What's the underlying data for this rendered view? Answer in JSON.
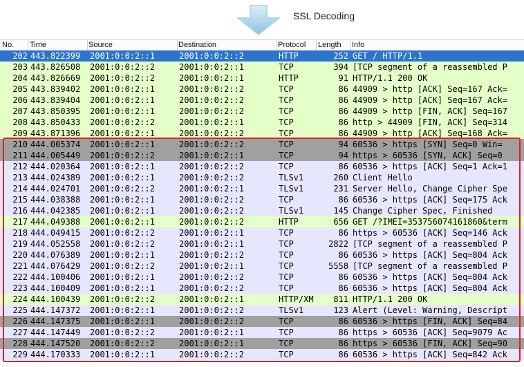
{
  "banner": {
    "title": "SSL Decoding",
    "icon": "down-arrow-icon"
  },
  "columns": [
    "No.",
    "Time",
    "Source",
    "Destination",
    "Protocol",
    "Length",
    "Info"
  ],
  "colors": {
    "http": "#e4ffc7",
    "tcp": "#e7e6ff",
    "gray": "#a0a0a0",
    "selected": "#2c74cc",
    "highlight_box": "#e02020"
  },
  "packets": [
    {
      "no": "202",
      "time": "443.822399",
      "src": "2001:0:0:2::1",
      "dst": "2001:0:0:2::2",
      "proto": "HTTP",
      "len": "252",
      "info": "GET / HTTP/1.1",
      "style": "sel"
    },
    {
      "no": "203",
      "time": "443.826508",
      "src": "2001:0:0:2::2",
      "dst": "2001:0:0:2::1",
      "proto": "TCP",
      "len": "394",
      "info": "[TCP segment of a reassembled P",
      "style": "http"
    },
    {
      "no": "204",
      "time": "443.826669",
      "src": "2001:0:0:2::2",
      "dst": "2001:0:0:2::1",
      "proto": "HTTP",
      "len": "91",
      "info": "HTTP/1.1 200 OK",
      "style": "http"
    },
    {
      "no": "205",
      "time": "443.839402",
      "src": "2001:0:0:2::1",
      "dst": "2001:0:0:2::2",
      "proto": "TCP",
      "len": "86",
      "info": "44909 > http [ACK] Seq=167 Ack=",
      "style": "http"
    },
    {
      "no": "206",
      "time": "443.839404",
      "src": "2001:0:0:2::1",
      "dst": "2001:0:0:2::2",
      "proto": "TCP",
      "len": "86",
      "info": "44909 > http [ACK] Seq=167 Ack=",
      "style": "http"
    },
    {
      "no": "207",
      "time": "443.850395",
      "src": "2001:0:0:2::1",
      "dst": "2001:0:0:2::2",
      "proto": "TCP",
      "len": "86",
      "info": "44909 > http [FIN, ACK] Seq=167",
      "style": "http"
    },
    {
      "no": "208",
      "time": "443.850433",
      "src": "2001:0:0:2::2",
      "dst": "2001:0:0:2::1",
      "proto": "TCP",
      "len": "86",
      "info": "http > 44909 [FIN, ACK] Seq=314",
      "style": "http"
    },
    {
      "no": "209",
      "time": "443.871396",
      "src": "2001:0:0:2::1",
      "dst": "2001:0:0:2::2",
      "proto": "TCP",
      "len": "86",
      "info": "44909 > http [ACK] Seq=168 Ack=",
      "style": "http"
    },
    {
      "no": "210",
      "time": "444.005374",
      "src": "2001:0:0:2::1",
      "dst": "2001:0:0:2::2",
      "proto": "TCP",
      "len": "94",
      "info": "60536 > https [SYN] Seq=0 Win=",
      "style": "gray"
    },
    {
      "no": "211",
      "time": "444.005449",
      "src": "2001:0:0:2::2",
      "dst": "2001:0:0:2::1",
      "proto": "TCP",
      "len": "94",
      "info": "https > 60536 [SYN, ACK] Seq=0",
      "style": "gray"
    },
    {
      "no": "212",
      "time": "444.020364",
      "src": "2001:0:0:2::1",
      "dst": "2001:0:0:2::2",
      "proto": "TCP",
      "len": "86",
      "info": "60536 > https [ACK] Seq=1 Ack=1",
      "style": "tcp"
    },
    {
      "no": "213",
      "time": "444.024389",
      "src": "2001:0:0:2::1",
      "dst": "2001:0:0:2::2",
      "proto": "TLSv1",
      "len": "260",
      "info": "Client Hello",
      "style": "tcp"
    },
    {
      "no": "214",
      "time": "444.024701",
      "src": "2001:0:0:2::2",
      "dst": "2001:0:0:2::1",
      "proto": "TLSv1",
      "len": "231",
      "info": "Server Hello, Change Cipher Spe",
      "style": "tcp"
    },
    {
      "no": "215",
      "time": "444.038388",
      "src": "2001:0:0:2::1",
      "dst": "2001:0:0:2::2",
      "proto": "TCP",
      "len": "86",
      "info": "60536 > https [ACK] Seq=175 Ack",
      "style": "tcp"
    },
    {
      "no": "216",
      "time": "444.042385",
      "src": "2001:0:0:2::1",
      "dst": "2001:0:0:2::2",
      "proto": "TLSv1",
      "len": "145",
      "info": "Change Cipher Spec, Finished",
      "style": "tcp"
    },
    {
      "no": "217",
      "time": "444.049388",
      "src": "2001:0:0:2::1",
      "dst": "2001:0:0:2::2",
      "proto": "HTTP",
      "len": "656",
      "info": "GET /?IMEI=353756074161860&term",
      "style": "http"
    },
    {
      "no": "218",
      "time": "444.049415",
      "src": "2001:0:0:2::2",
      "dst": "2001:0:0:2::1",
      "proto": "TCP",
      "len": "86",
      "info": "https > 60536 [ACK] Seq=146 Ack",
      "style": "tcp"
    },
    {
      "no": "219",
      "time": "444.052558",
      "src": "2001:0:0:2::2",
      "dst": "2001:0:0:2::1",
      "proto": "TCP",
      "len": "2822",
      "info": "[TCP segment of a reassembled P",
      "style": "tcp"
    },
    {
      "no": "220",
      "time": "444.076389",
      "src": "2001:0:0:2::1",
      "dst": "2001:0:0:2::2",
      "proto": "TCP",
      "len": "86",
      "info": "60536 > https [ACK] Seq=804 Ack",
      "style": "tcp"
    },
    {
      "no": "221",
      "time": "444.076429",
      "src": "2001:0:0:2::2",
      "dst": "2001:0:0:2::1",
      "proto": "TCP",
      "len": "5558",
      "info": "[TCP segment of a reassembled P",
      "style": "tcp"
    },
    {
      "no": "222",
      "time": "444.100406",
      "src": "2001:0:0:2::1",
      "dst": "2001:0:0:2::2",
      "proto": "TCP",
      "len": "86",
      "info": "60536 > https [ACK] Seq=804 Ack",
      "style": "tcp"
    },
    {
      "no": "223",
      "time": "444.100409",
      "src": "2001:0:0:2::1",
      "dst": "2001:0:0:2::2",
      "proto": "TCP",
      "len": "86",
      "info": "60536 > https [ACK] Seq=804 Ack",
      "style": "tcp"
    },
    {
      "no": "224",
      "time": "444.100439",
      "src": "2001:0:0:2::2",
      "dst": "2001:0:0:2::1",
      "proto": "HTTP/XM",
      "len": "811",
      "info": "HTTP/1.1 200 OK",
      "style": "http"
    },
    {
      "no": "225",
      "time": "444.147372",
      "src": "2001:0:0:2::1",
      "dst": "2001:0:0:2::2",
      "proto": "TLSv1",
      "len": "123",
      "info": "Alert (Level: Warning, Descript",
      "style": "tcp"
    },
    {
      "no": "226",
      "time": "444.147375",
      "src": "2001:0:0:2::1",
      "dst": "2001:0:0:2::2",
      "proto": "TCP",
      "len": "86",
      "info": "60536 > https [FIN, ACK] Seq=84",
      "style": "gray"
    },
    {
      "no": "227",
      "time": "444.147449",
      "src": "2001:0:0:2::2",
      "dst": "2001:0:0:2::1",
      "proto": "TCP",
      "len": "86",
      "info": "https > 60536 [ACK] Seq=9079 Ac",
      "style": "tcp"
    },
    {
      "no": "228",
      "time": "444.147520",
      "src": "2001:0:0:2::2",
      "dst": "2001:0:0:2::1",
      "proto": "TCP",
      "len": "86",
      "info": "https > 60536 [FIN, ACK] Seq=90",
      "style": "gray"
    },
    {
      "no": "229",
      "time": "444.170333",
      "src": "2001:0:0:2::1",
      "dst": "2001:0:0:2::2",
      "proto": "TCP",
      "len": "86",
      "info": "60536 > https [ACK] Seq=842 Ack",
      "style": "tcp"
    }
  ]
}
